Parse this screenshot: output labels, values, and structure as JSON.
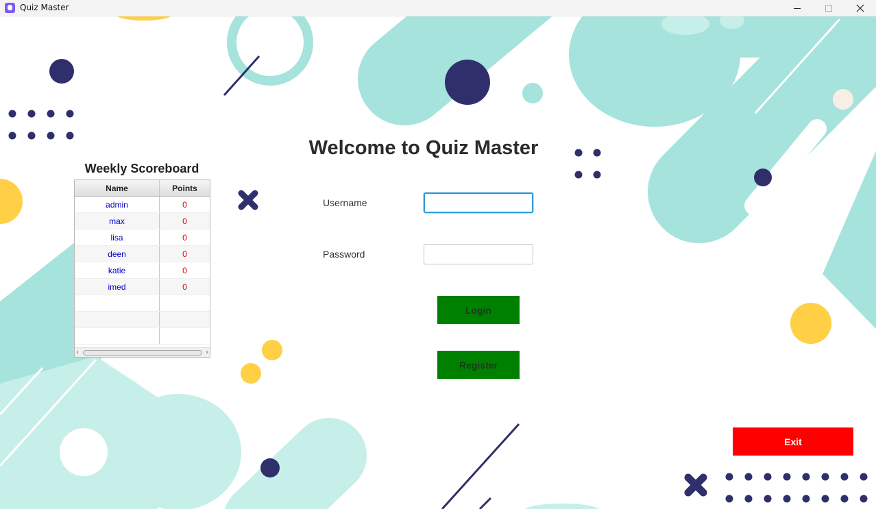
{
  "window": {
    "title": "Quiz Master",
    "app_icon": "quiz-app-icon"
  },
  "scoreboard": {
    "title": "Weekly Scoreboard",
    "columns": [
      "Name",
      "Points"
    ],
    "rows": [
      {
        "name": "admin",
        "points": "0"
      },
      {
        "name": "max",
        "points": "0"
      },
      {
        "name": "lisa",
        "points": "0"
      },
      {
        "name": "deen",
        "points": "0"
      },
      {
        "name": "katie",
        "points": "0"
      },
      {
        "name": "imed",
        "points": "0"
      }
    ]
  },
  "login": {
    "title": "Welcome to Quiz Master",
    "username_label": "Username",
    "username_value": "",
    "password_label": "Password",
    "password_value": "",
    "login_button": "Login",
    "register_button": "Register"
  },
  "exit_button": "Exit",
  "colors": {
    "mint": "#a6e3dc",
    "navy": "#2e2f6b",
    "yellow": "#ffd045",
    "login_green": "#008000",
    "exit_red": "#ff0000",
    "name_blue": "#0000cc",
    "points_red": "#dd0000"
  }
}
